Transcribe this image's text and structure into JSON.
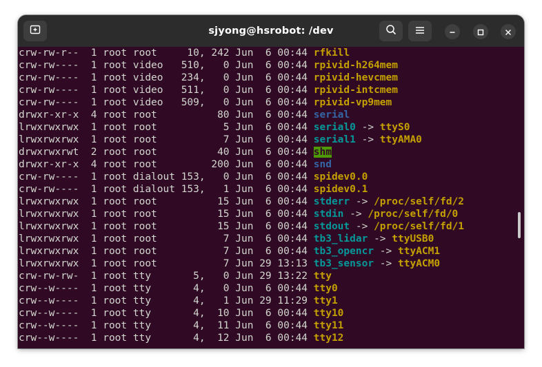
{
  "window": {
    "title": "sjyong@hsrobot: /dev"
  },
  "titlebar": {
    "new_tab_icon": "new-tab-icon",
    "search_icon": "search-icon",
    "menu_icon": "hamburger-menu-icon",
    "minimize_icon": "minimize-icon",
    "maximize_icon": "maximize-icon",
    "close_icon": "close-icon"
  },
  "colors": {
    "terminal_bg": "#300a24",
    "text": "#d3d7cf",
    "device": "#c4a000",
    "directory": "#3465a4",
    "symlink": "#06989a",
    "sticky_bg": "#4e9a06"
  },
  "listing": [
    {
      "prefix": "crw-rw-r--  1 root root     10, 242 Jun  6 00:44 ",
      "name": "rfkill",
      "kind": "dev",
      "arrow": "",
      "target": ""
    },
    {
      "prefix": "crw-rw----  1 root video   510,   0 Jun  6 00:44 ",
      "name": "rpivid-h264mem",
      "kind": "dev",
      "arrow": "",
      "target": ""
    },
    {
      "prefix": "crw-rw----  1 root video   234,   0 Jun  6 00:44 ",
      "name": "rpivid-hevcmem",
      "kind": "dev",
      "arrow": "",
      "target": ""
    },
    {
      "prefix": "crw-rw----  1 root video   511,   0 Jun  6 00:44 ",
      "name": "rpivid-intcmem",
      "kind": "dev",
      "arrow": "",
      "target": ""
    },
    {
      "prefix": "crw-rw----  1 root video   509,   0 Jun  6 00:44 ",
      "name": "rpivid-vp9mem",
      "kind": "dev",
      "arrow": "",
      "target": ""
    },
    {
      "prefix": "drwxr-xr-x  4 root root          80 Jun  6 00:44 ",
      "name": "serial",
      "kind": "dir",
      "arrow": "",
      "target": ""
    },
    {
      "prefix": "lrwxrwxrwx  1 root root           5 Jun  6 00:44 ",
      "name": "serial0",
      "kind": "link",
      "arrow": " -> ",
      "target": "ttyS0"
    },
    {
      "prefix": "lrwxrwxrwx  1 root root           7 Jun  6 00:44 ",
      "name": "serial1",
      "kind": "link",
      "arrow": " -> ",
      "target": "ttyAMA0"
    },
    {
      "prefix": "drwxrwxrwt  2 root root          40 Jun  6 00:44 ",
      "name": "shm",
      "kind": "sticky",
      "arrow": "",
      "target": ""
    },
    {
      "prefix": "drwxr-xr-x  4 root root         200 Jun  6 00:44 ",
      "name": "snd",
      "kind": "dir",
      "arrow": "",
      "target": ""
    },
    {
      "prefix": "crw-rw----  1 root dialout 153,   0 Jun  6 00:44 ",
      "name": "spidev0.0",
      "kind": "dev",
      "arrow": "",
      "target": ""
    },
    {
      "prefix": "crw-rw----  1 root dialout 153,   1 Jun  6 00:44 ",
      "name": "spidev0.1",
      "kind": "dev",
      "arrow": "",
      "target": ""
    },
    {
      "prefix": "lrwxrwxrwx  1 root root          15 Jun  6 00:44 ",
      "name": "stderr",
      "kind": "link",
      "arrow": " -> ",
      "target": "/proc/self/fd/2"
    },
    {
      "prefix": "lrwxrwxrwx  1 root root          15 Jun  6 00:44 ",
      "name": "stdin",
      "kind": "link",
      "arrow": " -> ",
      "target": "/proc/self/fd/0"
    },
    {
      "prefix": "lrwxrwxrwx  1 root root          15 Jun  6 00:44 ",
      "name": "stdout",
      "kind": "link",
      "arrow": " -> ",
      "target": "/proc/self/fd/1"
    },
    {
      "prefix": "lrwxrwxrwx  1 root root           7 Jun  6 00:44 ",
      "name": "tb3_lidar",
      "kind": "link",
      "arrow": " -> ",
      "target": "ttyUSB0"
    },
    {
      "prefix": "lrwxrwxrwx  1 root root           7 Jun  6 00:44 ",
      "name": "tb3_opencr",
      "kind": "link",
      "arrow": " -> ",
      "target": "ttyACM1"
    },
    {
      "prefix": "lrwxrwxrwx  1 root root           7 Jun 29 13:13 ",
      "name": "tb3_sensor",
      "kind": "link",
      "arrow": " -> ",
      "target": "ttyACM0"
    },
    {
      "prefix": "crw-rw-rw-  1 root tty       5,   0 Jun 29 13:22 ",
      "name": "tty",
      "kind": "dev",
      "arrow": "",
      "target": ""
    },
    {
      "prefix": "crw--w----  1 root tty       4,   0 Jun  6 00:44 ",
      "name": "tty0",
      "kind": "dev",
      "arrow": "",
      "target": ""
    },
    {
      "prefix": "crw--w----  1 root tty       4,   1 Jun 29 11:29 ",
      "name": "tty1",
      "kind": "dev",
      "arrow": "",
      "target": ""
    },
    {
      "prefix": "crw--w----  1 root tty       4,  10 Jun  6 00:44 ",
      "name": "tty10",
      "kind": "dev",
      "arrow": "",
      "target": ""
    },
    {
      "prefix": "crw--w----  1 root tty       4,  11 Jun  6 00:44 ",
      "name": "tty11",
      "kind": "dev",
      "arrow": "",
      "target": ""
    },
    {
      "prefix": "crw--w----  1 root tty       4,  12 Jun  6 00:44 ",
      "name": "tty12",
      "kind": "dev",
      "arrow": "",
      "target": ""
    }
  ]
}
